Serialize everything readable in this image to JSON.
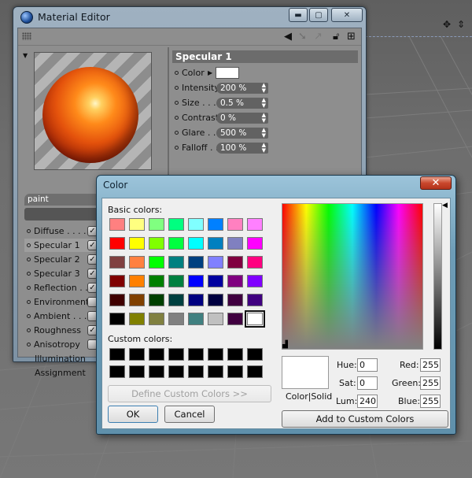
{
  "material_editor": {
    "title": "Material Editor",
    "material_name": "paint",
    "channels": [
      {
        "label": "Diffuse . . . .",
        "checked": true,
        "dot": true
      },
      {
        "label": "Specular 1",
        "checked": true,
        "dot": true,
        "selected": true
      },
      {
        "label": "Specular 2",
        "checked": true,
        "dot": true
      },
      {
        "label": "Specular 3",
        "checked": true,
        "dot": true
      },
      {
        "label": "Reflection . .",
        "checked": true,
        "dot": true
      },
      {
        "label": "Environment",
        "checked": false,
        "dot": true
      },
      {
        "label": "Ambient . . .",
        "checked": false,
        "dot": true
      },
      {
        "label": "Roughness",
        "checked": true,
        "dot": true
      },
      {
        "label": "Anisotropy",
        "checked": false,
        "dot": true
      },
      {
        "label": "Illumination",
        "checked": null,
        "dot": false
      },
      {
        "label": "Assignment",
        "checked": null,
        "dot": false
      }
    ],
    "section_title": "Specular 1",
    "color_label": "Color",
    "properties": [
      {
        "label": "Intensity",
        "value": "200 %"
      },
      {
        "label": "Size . . .",
        "value": "0.5 %"
      },
      {
        "label": "Contrast",
        "value": "0 %"
      },
      {
        "label": "Glare . .",
        "value": "500 %"
      },
      {
        "label": "Falloff . .",
        "value": "100 %"
      }
    ],
    "preview_colors": {
      "sphere": "#e4520c",
      "stripes_light": "#b5b5b5",
      "stripes_dark": "#8d8d8d"
    }
  },
  "color_dialog": {
    "title": "Color",
    "close_label": "✕",
    "basic_colors_label": "Basic colors:",
    "basic_colors": [
      "#ff8080",
      "#ffff80",
      "#80ff80",
      "#00ff80",
      "#80ffff",
      "#0080ff",
      "#ff80c0",
      "#ff80ff",
      "#ff0000",
      "#ffff00",
      "#80ff00",
      "#00ff40",
      "#00ffff",
      "#0080c0",
      "#8080c0",
      "#ff00ff",
      "#804040",
      "#ff8040",
      "#00ff00",
      "#008080",
      "#004080",
      "#8080ff",
      "#800040",
      "#ff0080",
      "#800000",
      "#ff8000",
      "#008000",
      "#008040",
      "#0000ff",
      "#0000a0",
      "#800080",
      "#8000ff",
      "#400000",
      "#804000",
      "#004000",
      "#004040",
      "#000080",
      "#000040",
      "#400040",
      "#400080",
      "#000000",
      "#808000",
      "#808040",
      "#808080",
      "#408080",
      "#c0c0c0",
      "#400040",
      "#ffffff"
    ],
    "selected_index": 47,
    "custom_colors_label": "Custom colors:",
    "custom_colors": [
      "#000000",
      "#000000",
      "#000000",
      "#000000",
      "#000000",
      "#000000",
      "#000000",
      "#000000",
      "#000000",
      "#000000",
      "#000000",
      "#000000",
      "#000000",
      "#000000",
      "#000000",
      "#000000"
    ],
    "define_custom_label": "Define Custom Colors >>",
    "ok_label": "OK",
    "cancel_label": "Cancel",
    "color_solid_label": "Color|Solid",
    "hue_label": "Hue:",
    "hue": "0",
    "sat_label": "Sat:",
    "sat": "0",
    "lum_label": "Lum:",
    "lum": "240",
    "red_label": "Red:",
    "red": "255",
    "green_label": "Green:",
    "green": "255",
    "blue_label": "Blue:",
    "blue": "255",
    "add_custom_label": "Add to Custom Colors"
  }
}
